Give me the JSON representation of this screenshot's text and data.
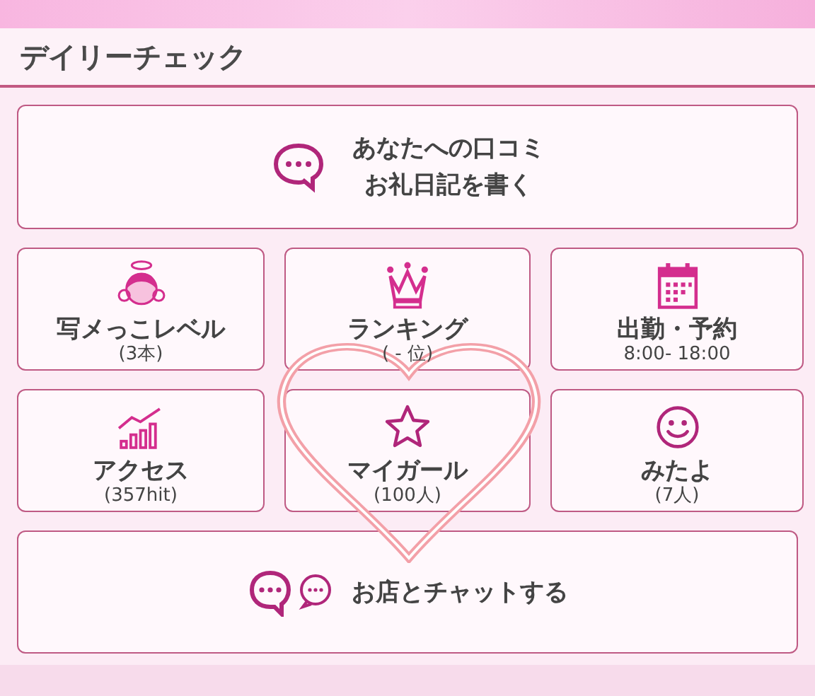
{
  "header": {
    "title": "デイリーチェック"
  },
  "review_button": {
    "lines": [
      "あなたへの口コミ",
      "お礼日記を書く"
    ]
  },
  "tiles": [
    {
      "kind": "angel",
      "title": "写メっこレベル",
      "sub": "(3本)"
    },
    {
      "kind": "crown",
      "title": "ランキング",
      "sub": "( - 位)"
    },
    {
      "kind": "calendar",
      "title": "出勤・予約",
      "sub": "8:00- 18:00"
    },
    {
      "kind": "chart",
      "title": "アクセス",
      "sub": "(357hit)"
    },
    {
      "kind": "star",
      "title": "マイガール",
      "sub": "(100人)"
    },
    {
      "kind": "smile",
      "title": "みたよ",
      "sub": "(7人)"
    }
  ],
  "chat_button": {
    "label": "お店とチャットする"
  }
}
